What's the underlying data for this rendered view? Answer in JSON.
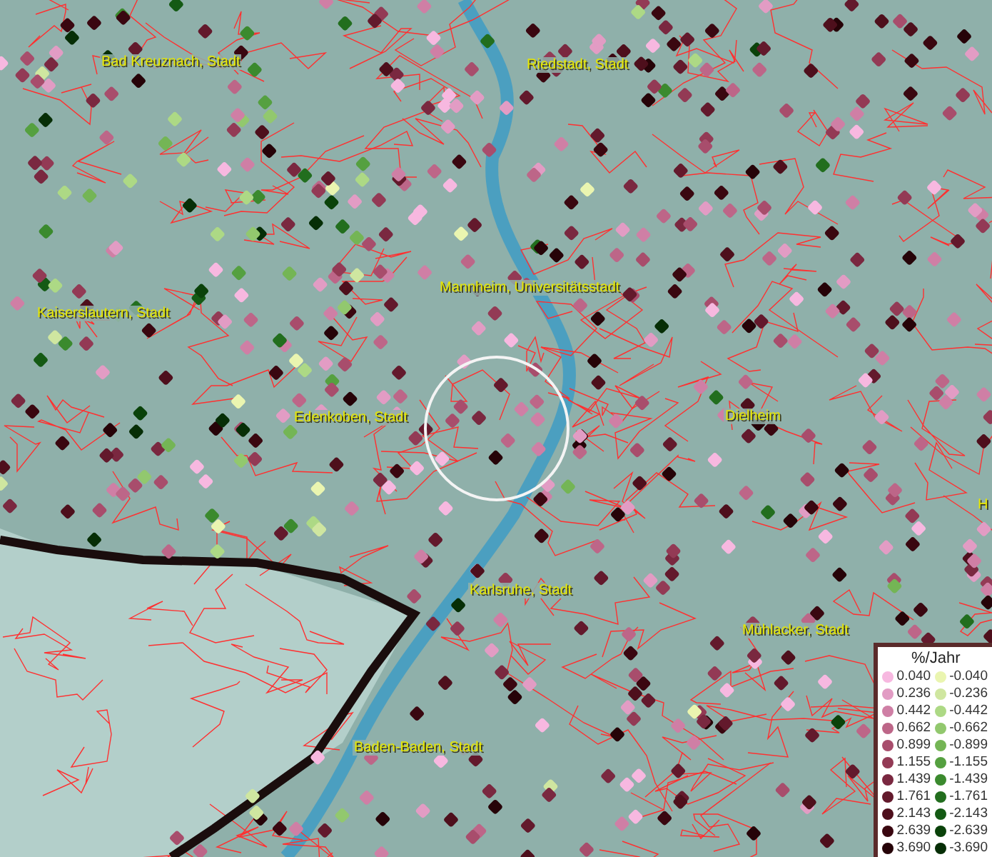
{
  "map": {
    "place_labels": [
      {
        "text": "Bad Kreuznach, Stadt"
      },
      {
        "text": "Riedstadt, Stadt"
      },
      {
        "text": "Kaiserslautern, Stadt"
      },
      {
        "text": "Mannheim, Universitätsstadt"
      },
      {
        "text": "Edenkoben, Stadt"
      },
      {
        "text": "Dielheim"
      },
      {
        "text": "H"
      },
      {
        "text": "Karlsruhe, Stadt"
      },
      {
        "text": "Mühlacker, Stadt"
      },
      {
        "text": "Baden-Baden, Stadt"
      }
    ]
  },
  "legend": {
    "title": "%/Jahr",
    "rows": [
      {
        "positive": {
          "label": "0.040",
          "color": "#f7b8e0"
        },
        "negative": {
          "label": "-0.040",
          "color": "#eaf5b0"
        }
      },
      {
        "positive": {
          "label": "0.236",
          "color": "#e29cc4"
        },
        "negative": {
          "label": "-0.236",
          "color": "#cfe6a0"
        }
      },
      {
        "positive": {
          "label": "0.442",
          "color": "#cf7fa5"
        },
        "negative": {
          "label": "-0.442",
          "color": "#add985"
        }
      },
      {
        "positive": {
          "label": "0.662",
          "color": "#bd6688"
        },
        "negative": {
          "label": "-0.662",
          "color": "#92c86e"
        }
      },
      {
        "positive": {
          "label": "0.899",
          "color": "#a84d6c"
        },
        "negative": {
          "label": "-0.899",
          "color": "#74b555"
        }
      },
      {
        "positive": {
          "label": "1.155",
          "color": "#933a55"
        },
        "negative": {
          "label": "-1.155",
          "color": "#55a040"
        }
      },
      {
        "positive": {
          "label": "1.439",
          "color": "#7a2840"
        },
        "negative": {
          "label": "-1.439",
          "color": "#3b8a2e"
        }
      },
      {
        "positive": {
          "label": "1.761",
          "color": "#63192c"
        },
        "negative": {
          "label": "-1.761",
          "color": "#226e1e"
        }
      },
      {
        "positive": {
          "label": "2.143",
          "color": "#4e0f1c"
        },
        "negative": {
          "label": "-2.143",
          "color": "#145a14"
        }
      },
      {
        "positive": {
          "label": "2.639",
          "color": "#3a0710"
        },
        "negative": {
          "label": "-2.639",
          "color": "#0a420a"
        }
      },
      {
        "positive": {
          "label": "3.690",
          "color": "#260308"
        },
        "negative": {
          "label": "-3.690",
          "color": "#062e06"
        }
      }
    ]
  }
}
